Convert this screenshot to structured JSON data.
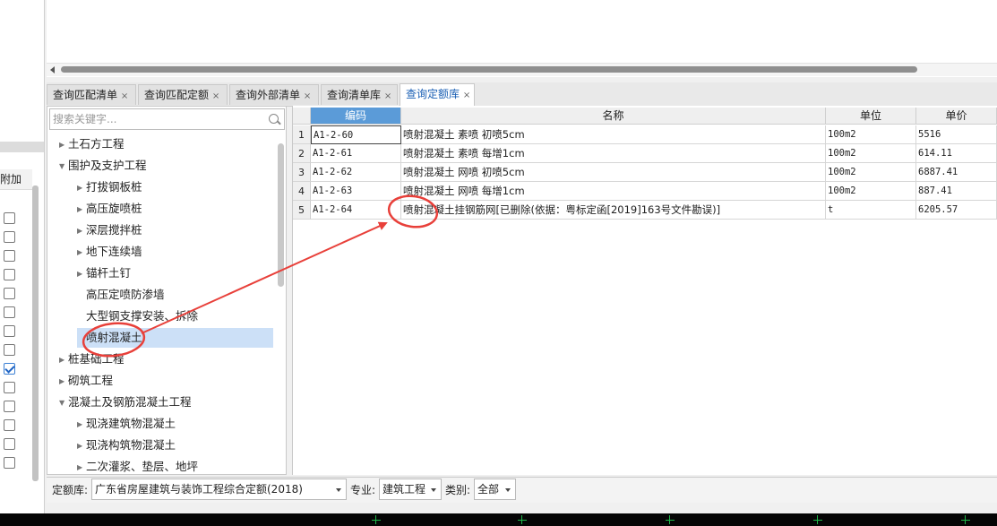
{
  "left_panel": {
    "header": "附加",
    "checkboxes": [
      false,
      false,
      false,
      false,
      false,
      false,
      false,
      false,
      true,
      false,
      false,
      false,
      false,
      false
    ]
  },
  "tabs": [
    {
      "label": "查询匹配清单",
      "active": false
    },
    {
      "label": "查询匹配定额",
      "active": false
    },
    {
      "label": "查询外部清单",
      "active": false
    },
    {
      "label": "查询清单库",
      "active": false
    },
    {
      "label": "查询定额库",
      "active": true
    }
  ],
  "tab_close_glyph": "×",
  "search": {
    "placeholder": "搜索关键字..."
  },
  "tree": [
    {
      "label": "土石方工程",
      "level": 0,
      "expander": "collapsed"
    },
    {
      "label": "围护及支护工程",
      "level": 0,
      "expander": "expanded"
    },
    {
      "label": "打拔钢板桩",
      "level": 1,
      "expander": "collapsed"
    },
    {
      "label": "高压旋喷桩",
      "level": 1,
      "expander": "collapsed"
    },
    {
      "label": "深层搅拌桩",
      "level": 1,
      "expander": "collapsed"
    },
    {
      "label": "地下连续墙",
      "level": 1,
      "expander": "collapsed"
    },
    {
      "label": "锚杆土钉",
      "level": 1,
      "expander": "collapsed"
    },
    {
      "label": "高压定喷防渗墙",
      "level": 1,
      "expander": "none"
    },
    {
      "label": "大型钢支撑安装、拆除",
      "level": 1,
      "expander": "none"
    },
    {
      "label": "喷射混凝土",
      "level": 1,
      "expander": "none",
      "selected": true
    },
    {
      "label": "桩基础工程",
      "level": 0,
      "expander": "collapsed"
    },
    {
      "label": "砌筑工程",
      "level": 0,
      "expander": "collapsed"
    },
    {
      "label": "混凝土及钢筋混凝土工程",
      "level": 0,
      "expander": "expanded"
    },
    {
      "label": "现浇建筑物混凝土",
      "level": 1,
      "expander": "collapsed"
    },
    {
      "label": "现浇构筑物混凝土",
      "level": 1,
      "expander": "collapsed"
    },
    {
      "label": "二次灌浆、垫层、地坪",
      "level": 1,
      "expander": "collapsed"
    }
  ],
  "grid": {
    "columns": [
      "编码",
      "名称",
      "单位",
      "单价"
    ],
    "rows": [
      {
        "num": "1",
        "code": "A1-2-60",
        "name": "喷射混凝土 素喷 初喷5cm",
        "unit": "100m2",
        "price": "5516"
      },
      {
        "num": "2",
        "code": "A1-2-61",
        "name": "喷射混凝土 素喷 每增1cm",
        "unit": "100m2",
        "price": "614.11"
      },
      {
        "num": "3",
        "code": "A1-2-62",
        "name": "喷射混凝土 网喷 初喷5cm",
        "unit": "100m2",
        "price": "6887.41"
      },
      {
        "num": "4",
        "code": "A1-2-63",
        "name": "喷射混凝土 网喷 每增1cm",
        "unit": "100m2",
        "price": "887.41"
      },
      {
        "num": "5",
        "code": "A1-2-64",
        "name": "喷射混凝土挂钢筋网[已删除(依据：粤标定函[2019]163号文件勘误)]",
        "unit": "t",
        "price": "6205.57"
      }
    ]
  },
  "filters": {
    "quota_label": "定额库:",
    "quota_value": "广东省房屋建筑与装饰工程综合定额(2018)",
    "specialty_label": "专业:",
    "specialty_value": "建筑工程",
    "category_label": "类别:",
    "category_value": "全部"
  },
  "colors": {
    "accent": "#1a5fb4",
    "selected_header": "#5b9bd8",
    "tree_selection": "#cce0f7",
    "annotation": "#e8403a"
  }
}
